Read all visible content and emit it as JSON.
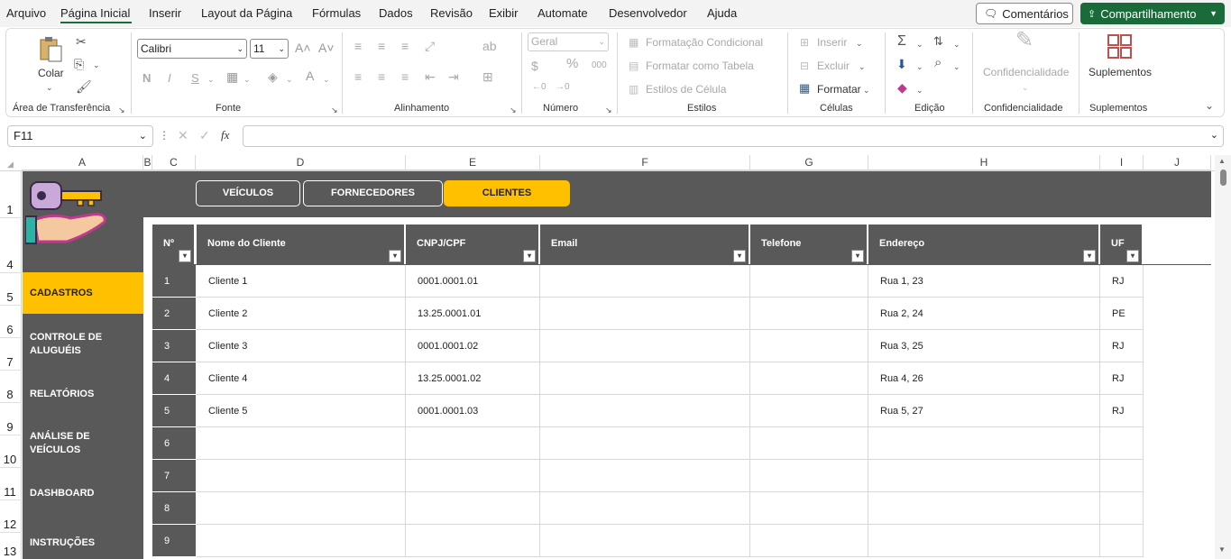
{
  "menu": {
    "items": [
      "Arquivo",
      "Página Inicial",
      "Inserir",
      "Layout da Página",
      "Fórmulas",
      "Dados",
      "Revisão",
      "Exibir",
      "Automate",
      "Desenvolvedor",
      "Ajuda"
    ],
    "active": "Página Inicial",
    "comments_label": "Comentários",
    "share_label": "Compartilhamento"
  },
  "ribbon": {
    "paste_label": "Colar",
    "font_name": "Calibri",
    "font_size": "11",
    "number_format": "Geral",
    "bold": "N",
    "italic": "I",
    "underline": "S",
    "conditional_format": "Formatação Condicional",
    "format_as_table": "Formatar como Tabela",
    "cell_styles": "Estilos de Célula",
    "insert": "Inserir",
    "delete": "Excluir",
    "format": "Formatar",
    "confidentiality": "Confidencialidade",
    "addins": "Suplementos",
    "groups": [
      "Área de Transferência",
      "Fonte",
      "Alinhamento",
      "Número",
      "Estilos",
      "Células",
      "Edição",
      "Confidencialidade",
      "Suplementos"
    ]
  },
  "formula": {
    "name_box": "F11",
    "fx": "fx",
    "content": ""
  },
  "grid": {
    "columns": [
      "A",
      "B",
      "C",
      "D",
      "E",
      "F",
      "G",
      "H",
      "I",
      "J"
    ],
    "rows": [
      "1",
      "4",
      "5",
      "6",
      "7",
      "8",
      "9",
      "10",
      "11",
      "12",
      "13"
    ]
  },
  "sidebar": {
    "items": [
      "CADASTROS",
      "CONTROLE DE ALUGUÉIS",
      "RELATÓRIOS",
      "ANÁLISE DE VEÍCULOS",
      "DASHBOARD",
      "INSTRUÇÕES"
    ],
    "selected": "CADASTROS"
  },
  "tabs": {
    "items": [
      "VEÍCULOS",
      "FORNECEDORES",
      "CLIENTES"
    ],
    "selected": "CLIENTES"
  },
  "table": {
    "headers": [
      "Nº",
      "Nome do Cliente",
      "CNPJ/CPF",
      "Email",
      "Telefone",
      "Endereço",
      "UF"
    ],
    "rows": [
      [
        "1",
        "Cliente 1",
        "0001.0001.01",
        "",
        "",
        "Rua 1, 23",
        "RJ"
      ],
      [
        "2",
        "Cliente 2",
        "13.25.0001.01",
        "",
        "",
        "Rua 2, 24",
        "PE"
      ],
      [
        "3",
        "Cliente 3",
        "0001.0001.02",
        "",
        "",
        "Rua 3, 25",
        "RJ"
      ],
      [
        "4",
        "Cliente 4",
        "13.25.0001.02",
        "",
        "",
        "Rua 4, 26",
        "RJ"
      ],
      [
        "5",
        "Cliente 5",
        "0001.0001.03",
        "",
        "",
        "Rua 5, 27",
        "RJ"
      ],
      [
        "6",
        "",
        "",
        "",
        "",
        "",
        ""
      ],
      [
        "7",
        "",
        "",
        "",
        "",
        "",
        ""
      ],
      [
        "8",
        "",
        "",
        "",
        "",
        "",
        ""
      ],
      [
        "9",
        "",
        "",
        "",
        "",
        "",
        ""
      ]
    ]
  },
  "colors": {
    "accent": "#ffc000",
    "dark": "#595959",
    "brand": "#1b6b3a"
  }
}
